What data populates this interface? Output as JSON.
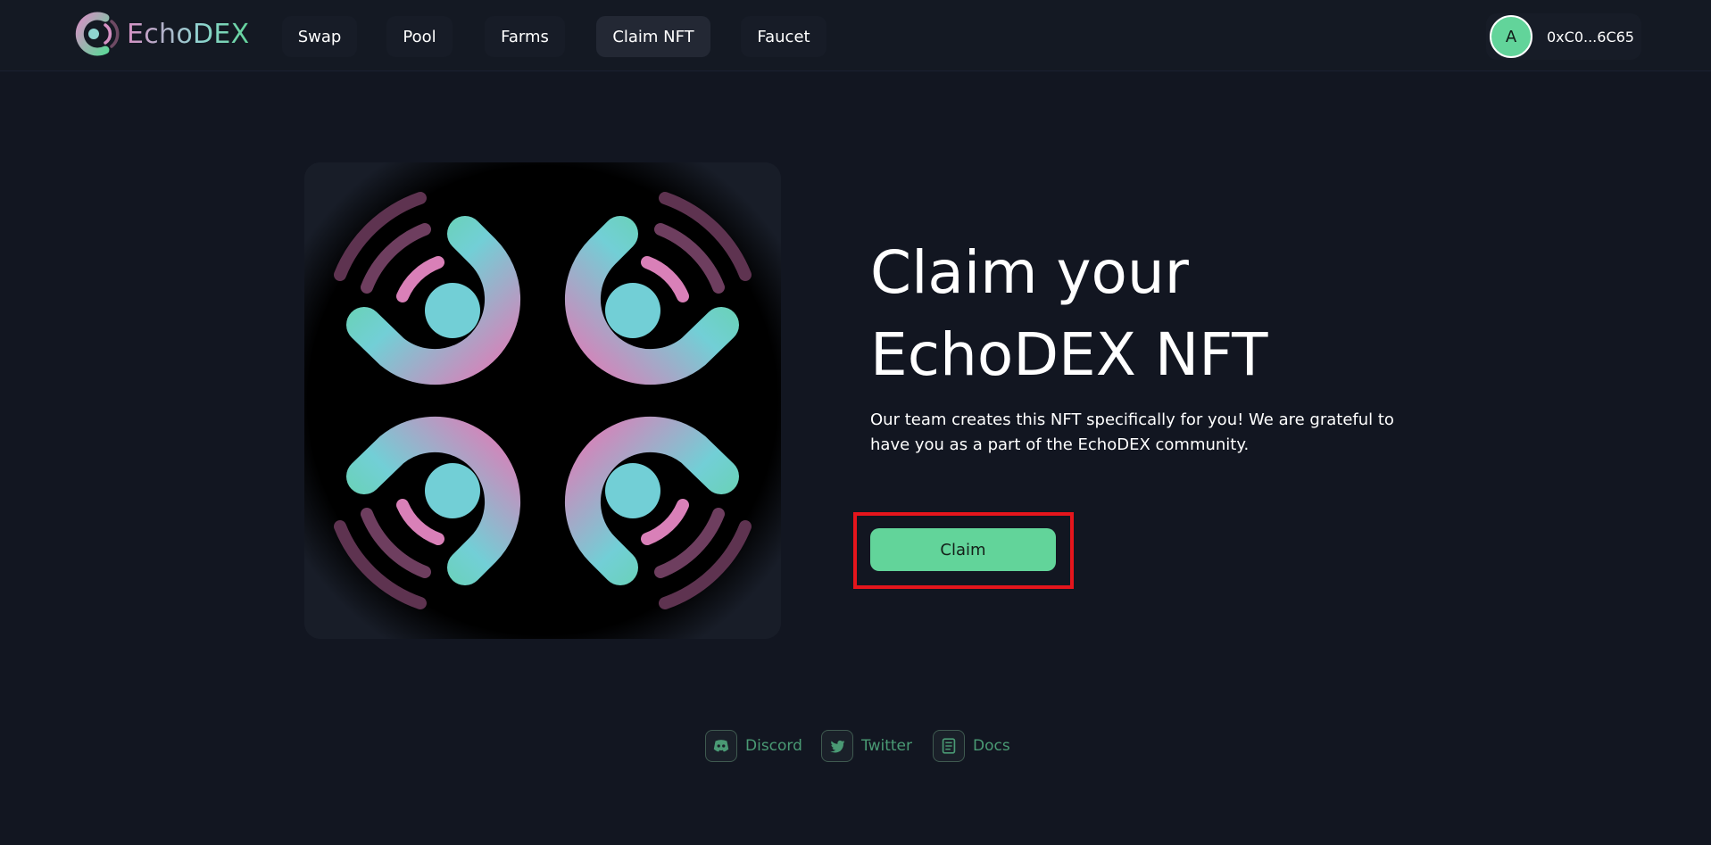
{
  "brand": {
    "name": "EchoDEX"
  },
  "nav": {
    "items": [
      {
        "label": "Swap"
      },
      {
        "label": "Pool"
      },
      {
        "label": "Farms"
      },
      {
        "label": "Claim NFT"
      },
      {
        "label": "Faucet"
      }
    ],
    "active": "Claim NFT"
  },
  "account": {
    "avatar_letter": "A",
    "address": "0xC0...6C65"
  },
  "main": {
    "title_line1": "Claim your",
    "title_line2": "EchoDEX NFT",
    "description": "Our team creates this NFT specifically for you! We are grateful to have you as a part of the EchoDEX community.",
    "claim_label": "Claim"
  },
  "footer": {
    "links": [
      {
        "label": "Discord",
        "icon": "discord-icon"
      },
      {
        "label": "Twitter",
        "icon": "twitter-icon"
      },
      {
        "label": "Docs",
        "icon": "docs-icon"
      }
    ]
  },
  "colors": {
    "background": "#121621",
    "accent_green": "#62d49a",
    "accent_pink": "#d591c4",
    "highlight_red": "#e5151c"
  }
}
